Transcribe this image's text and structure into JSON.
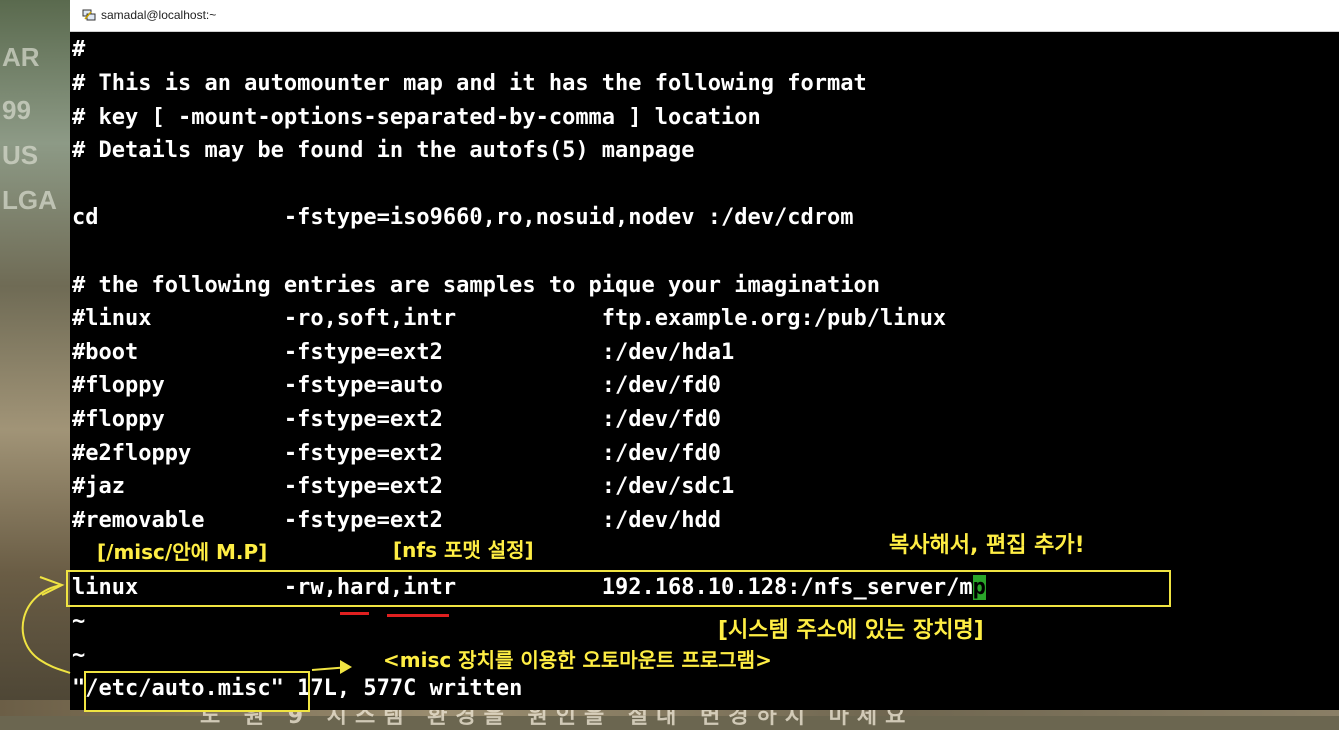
{
  "window": {
    "title": "samadal@localhost:~"
  },
  "background": {
    "left_fragments": [
      "AR",
      "99",
      "US",
      "LGA"
    ],
    "bottom_text": "도 원 9 시스템 환경을 원인을 절대 변경하지 마세요"
  },
  "terminal": {
    "lines": [
      "#",
      "# This is an automounter map and it has the following format",
      "# key [ -mount-options-separated-by-comma ] location",
      "# Details may be found in the autofs(5) manpage",
      "",
      "cd              -fstype=iso9660,ro,nosuid,nodev :/dev/cdrom",
      "",
      "# the following entries are samples to pique your imagination",
      "#linux          -ro,soft,intr           ftp.example.org:/pub/linux",
      "#boot           -fstype=ext2            :/dev/hda1",
      "#floppy         -fstype=auto            :/dev/fd0",
      "#floppy         -fstype=ext2            :/dev/fd0",
      "#e2floppy       -fstype=ext2            :/dev/fd0",
      "#jaz            -fstype=ext2            :/dev/sdc1",
      "#removable      -fstype=ext2            :/dev/hdd"
    ],
    "edited_line_before_cursor": "linux           -rw,hard,intr           192.168.10.128:/nfs_server/m",
    "cursor_char": "p",
    "tilde_lines": [
      "~",
      "~"
    ],
    "status_line": "\"/etc/auto.misc\" 17L, 577C written"
  },
  "annotations": {
    "mount_point": "[/misc/안에 M.P]",
    "nfs_format": "[nfs 포맷 설정]",
    "copy_edit": "복사해서, 편집 추가!",
    "device_name": "[시스템 주소에 있는 장치명]",
    "program_note": "<misc 장치를 이용한 오토마운트 프로그램>"
  },
  "colors": {
    "terminal_bg": "#000000",
    "terminal_fg": "#ffffff",
    "annotation": "#ffee44",
    "underline": "#e02020",
    "cursor": "#2aa52a"
  }
}
